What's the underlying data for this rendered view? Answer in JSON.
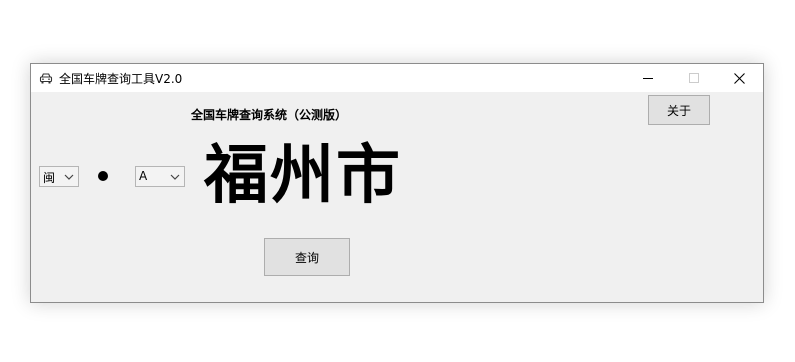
{
  "window": {
    "title": "全国车牌查询工具V2.0",
    "controls": {
      "minimize_icon": "minimize-icon",
      "maximize_icon": "maximize-icon",
      "close_icon": "close-icon"
    }
  },
  "header": {
    "text": "全国车牌查询系统（公测版）"
  },
  "about_button": {
    "label": "关于"
  },
  "province_select": {
    "value": "闽"
  },
  "letter_select": {
    "value": "A"
  },
  "result": {
    "city": "福州市"
  },
  "query_button": {
    "label": "查询"
  },
  "colors": {
    "window_bg": "#f0f0f0",
    "titlebar_bg": "#ffffff",
    "button_bg": "#e1e1e1",
    "button_border": "#adadad"
  }
}
